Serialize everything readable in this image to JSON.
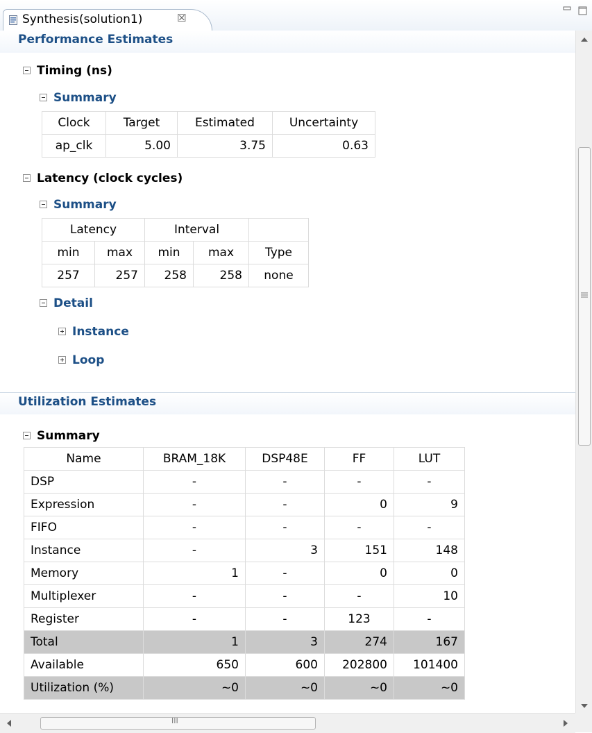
{
  "tab": {
    "title": "Synthesis(solution1)",
    "close": "☒"
  },
  "performance": {
    "title": "Performance Estimates",
    "timing": {
      "title": "Timing (ns)",
      "summary_title": "Summary",
      "headers": [
        "Clock",
        "Target",
        "Estimated",
        "Uncertainty"
      ],
      "row": [
        "ap_clk",
        "5.00",
        "3.75",
        "0.63"
      ]
    },
    "latency": {
      "title": "Latency (clock cycles)",
      "summary_title": "Summary",
      "group_headers": [
        "Latency",
        "Interval",
        ""
      ],
      "headers": [
        "min",
        "max",
        "min",
        "max",
        "Type"
      ],
      "row": [
        "257",
        "257",
        "258",
        "258",
        "none"
      ],
      "detail_title": "Detail",
      "instance_label": "Instance",
      "loop_label": "Loop"
    }
  },
  "utilization": {
    "title": "Utilization Estimates",
    "summary_title": "Summary",
    "headers": [
      "Name",
      "BRAM_18K",
      "DSP48E",
      "FF",
      "LUT"
    ],
    "rows": [
      [
        "DSP",
        "-",
        "-",
        "-",
        "-"
      ],
      [
        "Expression",
        "-",
        "-",
        "0",
        "9"
      ],
      [
        "FIFO",
        "-",
        "-",
        "-",
        "-"
      ],
      [
        "Instance",
        "-",
        "3",
        "151",
        "148"
      ],
      [
        "Memory",
        "1",
        "-",
        "0",
        "0"
      ],
      [
        "Multiplexer",
        "-",
        "-",
        "-",
        "10"
      ],
      [
        "Register",
        "-",
        "-",
        "123",
        "-"
      ],
      [
        "Total",
        "1",
        "3",
        "274",
        "167"
      ],
      [
        "Available",
        "650",
        "600",
        "202800",
        "101400"
      ],
      [
        "Utilization (%)",
        "~0",
        "~0",
        "~0",
        "~0"
      ]
    ]
  },
  "scroll": {
    "h_grip": "III"
  }
}
